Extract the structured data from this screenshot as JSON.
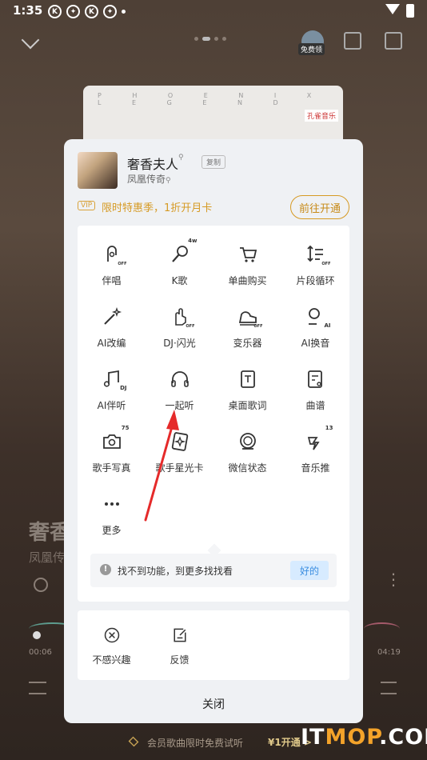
{
  "status_bar": {
    "time": "1:35",
    "icons": [
      "k-circle-icon",
      "pinwheel-icon",
      "k-circle-icon",
      "pinwheel-icon"
    ]
  },
  "player": {
    "free_label": "免费领",
    "album_text": "P H O E N I X   L E G E N D",
    "brand": "孔雀音乐",
    "song_title": "奢香",
    "artist": "凤凰传",
    "time_elapsed": "00:06",
    "time_total": "04:19"
  },
  "dialog": {
    "song": {
      "title": "奢香夫人",
      "copy_label": "复制",
      "artist": "凤凰传奇"
    },
    "vip": {
      "badge": "VIP",
      "text": "限时特惠季，1折开月卡",
      "button": "前往开通"
    },
    "items": [
      {
        "label": "伴唱",
        "icon": "mic-off-icon"
      },
      {
        "label": "K歌",
        "icon": "karaoke-mic-icon",
        "sup": "4w"
      },
      {
        "label": "单曲购买",
        "icon": "cart-icon"
      },
      {
        "label": "片段循环",
        "icon": "segment-loop-icon"
      },
      {
        "label": "AI改编",
        "icon": "magic-wand-icon"
      },
      {
        "label": "DJ·闪光",
        "icon": "hand-flash-icon"
      },
      {
        "label": "变乐器",
        "icon": "piano-icon"
      },
      {
        "label": "AI换音",
        "icon": "ai-voice-icon"
      },
      {
        "label": "AI伴听",
        "icon": "ai-music-note-icon"
      },
      {
        "label": "一起听",
        "icon": "headphones-icon"
      },
      {
        "label": "桌面歌词",
        "icon": "desktop-lyrics-icon"
      },
      {
        "label": "曲谱",
        "icon": "score-icon"
      },
      {
        "label": "歌手写真",
        "icon": "photo-search-icon",
        "sup": "75"
      },
      {
        "label": "歌手星光卡",
        "icon": "star-card-icon"
      },
      {
        "label": "微信状态",
        "icon": "wechat-status-icon"
      },
      {
        "label": "音乐推",
        "icon": "music-push-icon",
        "sup": "13"
      },
      {
        "label": "更多",
        "icon": "more-dots-icon"
      }
    ],
    "tip": {
      "text": "找不到功能，到更多找找看",
      "button": "好的"
    },
    "secondary": [
      {
        "label": "不感兴趣",
        "icon": "not-interested-icon"
      },
      {
        "label": "反馈",
        "icon": "feedback-icon"
      }
    ],
    "close": "关闭"
  },
  "banner": {
    "text": "会员歌曲限时免费试听",
    "cta": "¥1开通 >"
  },
  "watermark": {
    "it": "IT",
    "mp": "MOP",
    "rest": ".COM"
  }
}
